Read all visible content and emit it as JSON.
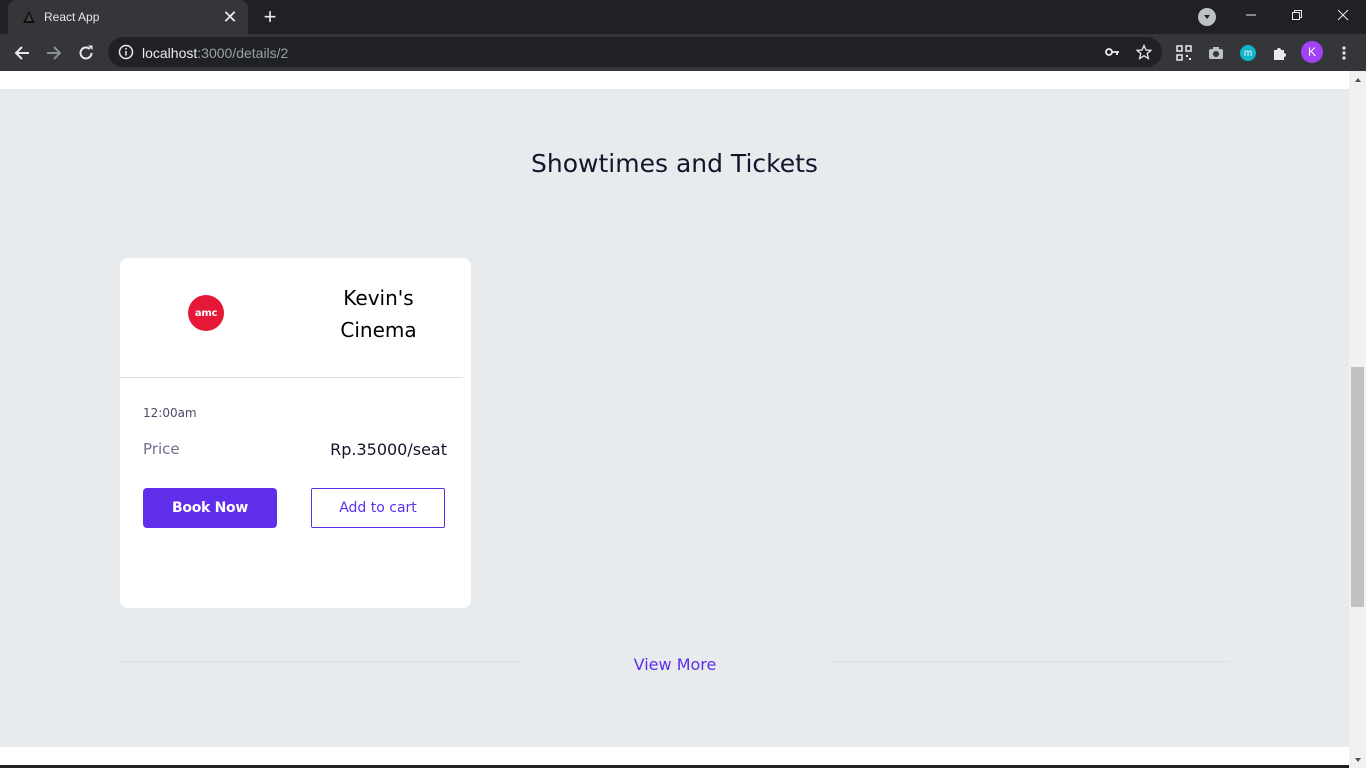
{
  "browser": {
    "tab_title": "React App",
    "new_tab_symbol": "+",
    "close_symbol": "✕",
    "url_host": "localhost",
    "url_path": ":3000/details/2",
    "profile_initial": "K",
    "extension_m_label": "m"
  },
  "page": {
    "section_title": "Showtimes and Tickets",
    "view_more_label": "View More"
  },
  "cinema_card": {
    "logo_text": "amc",
    "cinema_name": "Kevin's Cinema",
    "showtime": "12:00am",
    "price_label": "Price",
    "price_value": "Rp.35000/seat",
    "book_label": "Book Now",
    "cart_label": "Add to cart"
  },
  "colors": {
    "accent": "#5f2eea",
    "logo_red": "#e51937",
    "section_bg": "#e8ebee"
  }
}
